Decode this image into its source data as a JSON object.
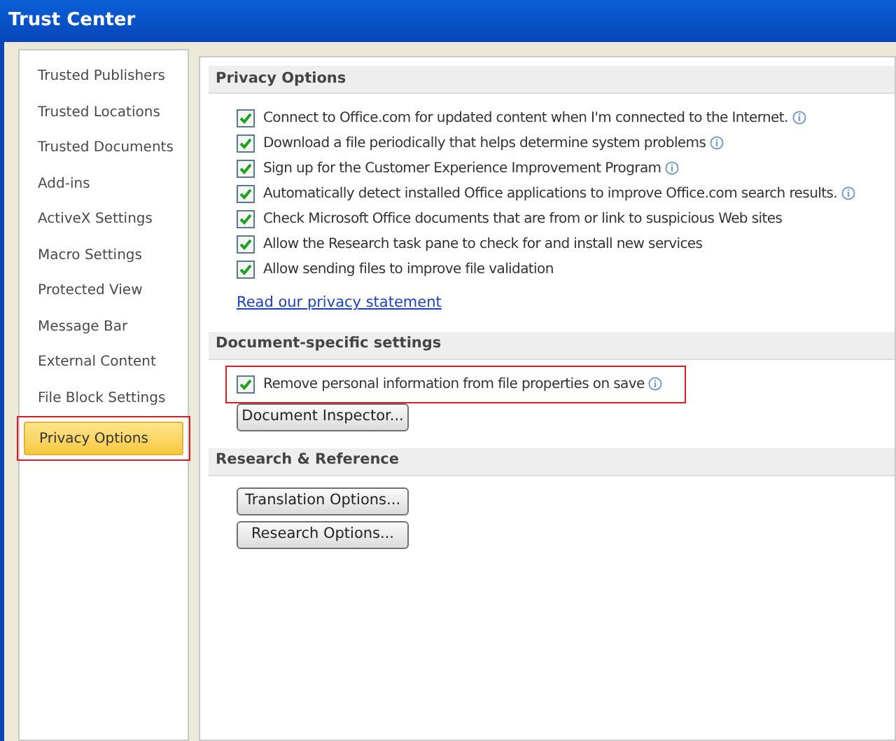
{
  "window": {
    "title": "Trust Center"
  },
  "sidebar": {
    "items": [
      {
        "label": "Trusted Publishers",
        "selected": false,
        "annotated": false
      },
      {
        "label": "Trusted Locations",
        "selected": false,
        "annotated": false
      },
      {
        "label": "Trusted Documents",
        "selected": false,
        "annotated": false
      },
      {
        "label": "Add-ins",
        "selected": false,
        "annotated": false
      },
      {
        "label": "ActiveX Settings",
        "selected": false,
        "annotated": false
      },
      {
        "label": "Macro Settings",
        "selected": false,
        "annotated": false
      },
      {
        "label": "Protected View",
        "selected": false,
        "annotated": false
      },
      {
        "label": "Message Bar",
        "selected": false,
        "annotated": false
      },
      {
        "label": "External Content",
        "selected": false,
        "annotated": false
      },
      {
        "label": "File Block Settings",
        "selected": false,
        "annotated": false
      },
      {
        "label": "Privacy Options",
        "selected": true,
        "annotated": true
      }
    ]
  },
  "sections": [
    {
      "title": "Privacy Options",
      "items": [
        {
          "kind": "checkbox",
          "label": "Connect to Office.com for updated content when I'm connected to the Internet.",
          "checked": true,
          "info": true
        },
        {
          "kind": "checkbox",
          "label": "Download a file periodically that helps determine system problems",
          "checked": true,
          "info": true
        },
        {
          "kind": "checkbox",
          "label": "Sign up for the Customer Experience Improvement Program",
          "checked": true,
          "info": true
        },
        {
          "kind": "checkbox",
          "label": "Automatically detect installed Office applications to improve Office.com search results.",
          "checked": true,
          "info": true
        },
        {
          "kind": "checkbox",
          "label": "Check Microsoft Office documents that are from or link to suspicious Web sites",
          "checked": true,
          "info": false
        },
        {
          "kind": "checkbox",
          "label": "Allow the Research task pane to check for and install new services",
          "checked": true,
          "info": false
        },
        {
          "kind": "checkbox",
          "label": "Allow sending files to improve file validation",
          "checked": true,
          "info": false
        },
        {
          "kind": "link",
          "label": "Read our privacy statement"
        }
      ]
    },
    {
      "title": "Document-specific settings",
      "items": [
        {
          "kind": "checkbox",
          "label": "Remove personal information from file properties on save",
          "checked": true,
          "info": true,
          "annotated": true
        },
        {
          "kind": "button",
          "label": "Document Inspector..."
        }
      ]
    },
    {
      "title": "Research & Reference",
      "items": [
        {
          "kind": "button",
          "label": "Translation Options..."
        },
        {
          "kind": "button",
          "label": "Research Options..."
        }
      ]
    }
  ]
}
